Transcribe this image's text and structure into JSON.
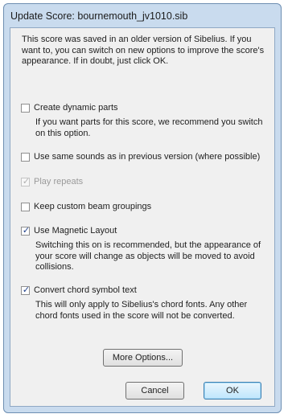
{
  "window": {
    "title": "Update Score: bournemouth_jv1010.sib"
  },
  "intro_text": "This score was saved in an older version of Sibelius. If you want to, you can switch on new options to improve the score's appearance. If in doubt, just click OK.",
  "options": [
    {
      "label": "Create dynamic parts",
      "checked": false,
      "disabled": false,
      "description": "If you want parts for this score, we recommend you switch on this option."
    },
    {
      "label": "Use same sounds as in previous version (where possible)",
      "checked": false,
      "disabled": false
    },
    {
      "label": "Play repeats",
      "checked": true,
      "disabled": true
    },
    {
      "label": "Keep custom beam groupings",
      "checked": false,
      "disabled": false
    },
    {
      "label": "Use Magnetic Layout",
      "checked": true,
      "disabled": false,
      "description": "Switching this on is recommended, but the appearance of your score will change as objects will be moved to avoid collisions."
    },
    {
      "label": "Convert chord symbol text",
      "checked": true,
      "disabled": false,
      "description": "This will only apply to Sibelius's chord fonts. Any other chord fonts used in the score will not be converted."
    }
  ],
  "buttons": {
    "more_options": "More Options...",
    "cancel": "Cancel",
    "ok": "OK"
  },
  "check_glyph": "✓"
}
